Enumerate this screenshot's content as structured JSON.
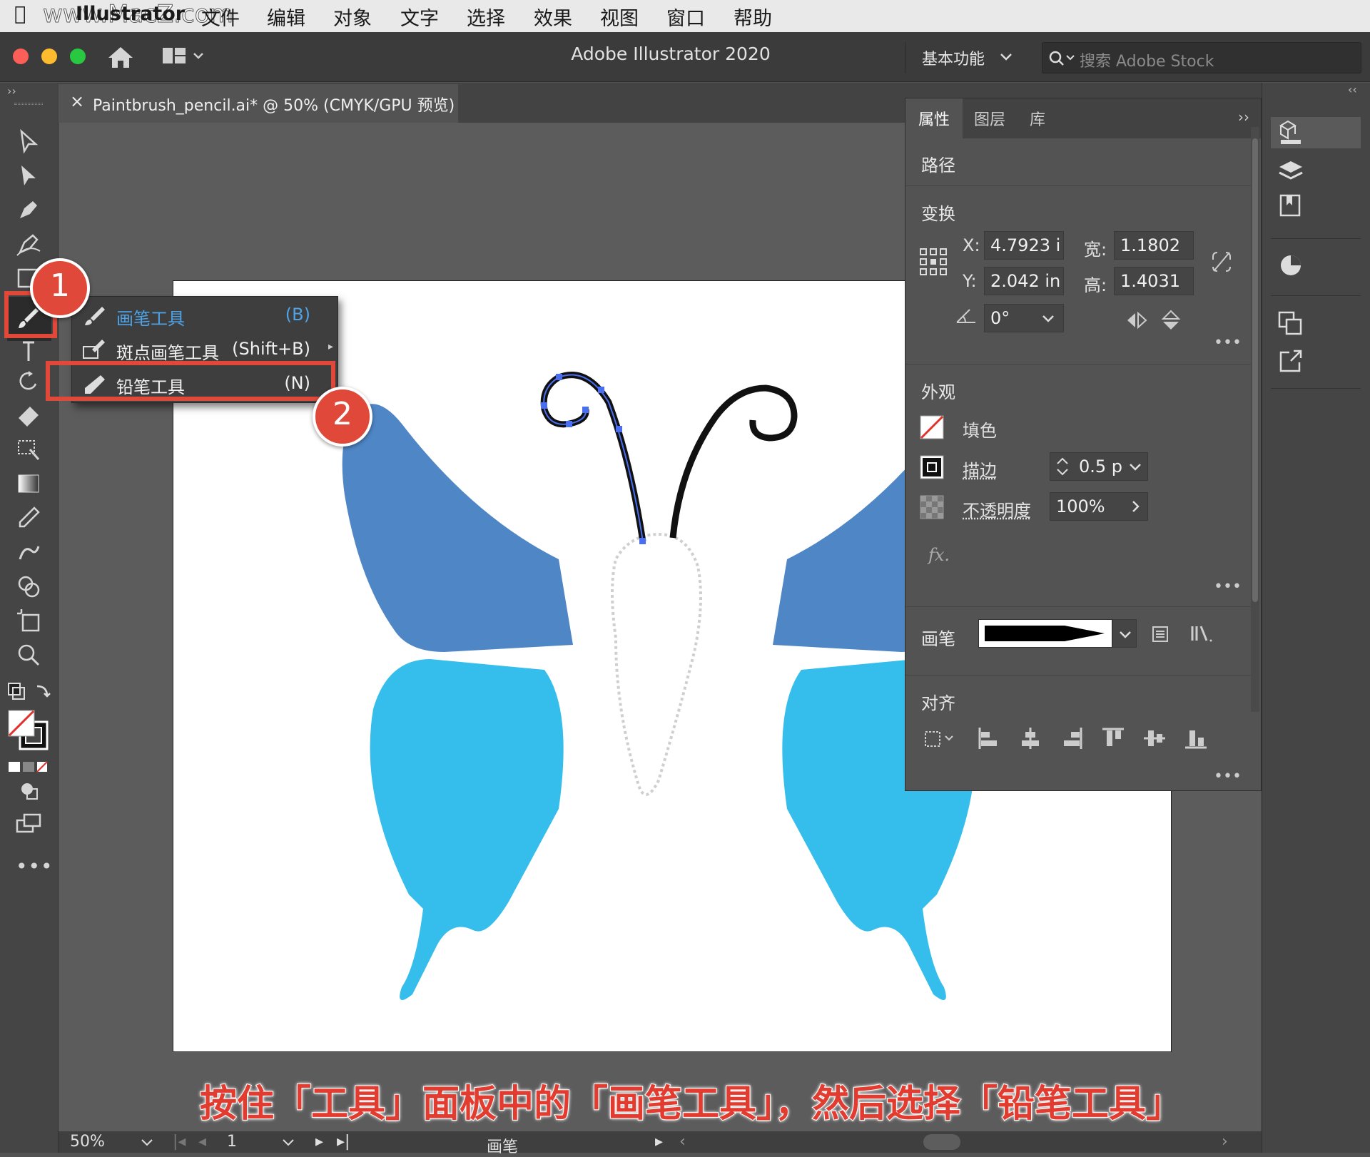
{
  "menubar": {
    "watermark": "www.MacZ.com",
    "app": "Illustrator",
    "items": [
      "文件",
      "编辑",
      "对象",
      "文字",
      "选择",
      "效果",
      "视图",
      "窗口",
      "帮助"
    ]
  },
  "titlebar": {
    "title": "Adobe Illustrator 2020",
    "workspace": "基本功能",
    "search_placeholder": "搜索 Adobe Stock"
  },
  "document_tab": {
    "close": "×",
    "title": "Paintbrush_pencil.ai* @ 50% (CMYK/GPU 预览)"
  },
  "flyout": {
    "items": [
      {
        "label": "画笔工具",
        "shortcut": "(B)",
        "icon": "paintbrush-icon",
        "selected": true
      },
      {
        "label": "斑点画笔工具",
        "shortcut": "(Shift+B)",
        "icon": "blob-brush-icon",
        "selected": false
      },
      {
        "label": "铅笔工具",
        "shortcut": "(N)",
        "icon": "pencil-icon",
        "selected": false
      }
    ],
    "accent": "#4ea3e6"
  },
  "properties": {
    "tabs": [
      "属性",
      "图层",
      "库"
    ],
    "object_type": "路径",
    "transform": {
      "title": "变换",
      "x_label": "X:",
      "x": "4.7923 i",
      "y_label": "Y:",
      "y": "2.042 in",
      "w_label": "宽:",
      "w": "1.1802 in",
      "h_label": "高:",
      "h": "1.4031 in",
      "angle": "0°"
    },
    "appearance": {
      "title": "外观",
      "fill": "填色",
      "stroke": "描边",
      "stroke_value": "0.5 p",
      "opacity_label": "不透明度",
      "opacity": "100%",
      "fx": "fx."
    },
    "brush_label": "画笔",
    "align_title": "对齐"
  },
  "callouts": [
    "1",
    "2"
  ],
  "caption": "按住「工具」面板中的「画笔工具」，然后选择「铅笔工具」",
  "statusbar": {
    "zoom": "50%",
    "page": "1",
    "tool": "画笔"
  },
  "colors": {
    "wing_top": "#4f86c6",
    "wing_bottom": "#35bdec",
    "callout": "#e0483a"
  }
}
